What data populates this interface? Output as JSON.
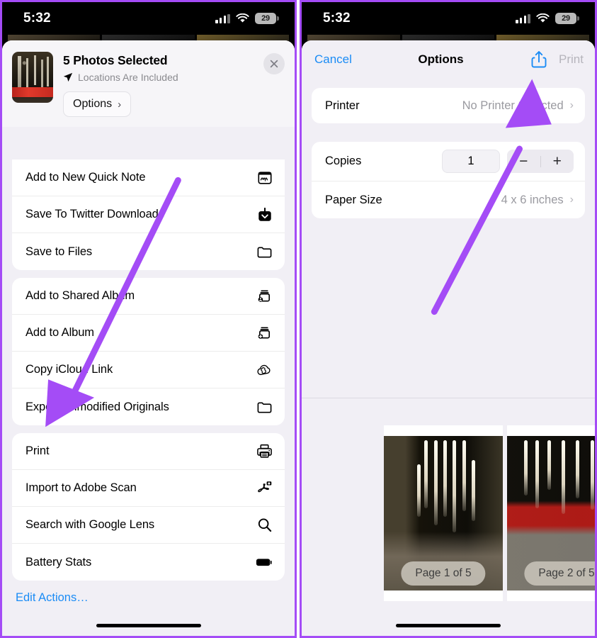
{
  "status_bar": {
    "time": "5:32",
    "battery": "29",
    "wifi_icon": "wifi-icon",
    "cellular_icon": "cellular-signal-icon"
  },
  "colors": {
    "accent_blue": "#1b8cf5",
    "annotation_purple": "#a44cf6",
    "sheet_bg": "#f1eff5",
    "muted": "#9a9aa0"
  },
  "left_panel": {
    "header": {
      "title": "5 Photos Selected",
      "subtitle": "Locations Are Included",
      "location_icon": "location-arrow-icon",
      "options_label": "Options",
      "options_chevron": "›",
      "close_icon": "close-icon"
    },
    "groups": [
      {
        "clipped": true,
        "rows": [
          {
            "label": "Add to New Quick Note",
            "icon": "quick-note-icon"
          },
          {
            "label": "Save To Twitter Downloads",
            "icon": "download-box-icon"
          },
          {
            "label": "Save to Files",
            "icon": "folder-icon"
          }
        ]
      },
      {
        "clipped": false,
        "rows": [
          {
            "label": "Add to Shared Album",
            "icon": "shared-album-icon"
          },
          {
            "label": "Add to Album",
            "icon": "add-album-icon"
          },
          {
            "label": "Copy iCloud Link",
            "icon": "icloud-link-icon"
          },
          {
            "label": "Export Unmodified Originals",
            "icon": "folder-icon"
          }
        ]
      },
      {
        "clipped": false,
        "rows": [
          {
            "label": "Print",
            "icon": "printer-icon"
          },
          {
            "label": "Import to Adobe Scan",
            "icon": "adobe-scan-icon"
          },
          {
            "label": "Search with Google Lens",
            "icon": "search-icon"
          },
          {
            "label": "Battery Stats",
            "icon": "battery-icon"
          }
        ]
      }
    ],
    "edit_actions_label": "Edit Actions…"
  },
  "right_panel": {
    "nav": {
      "cancel_label": "Cancel",
      "title": "Options",
      "share_icon": "share-icon",
      "print_label": "Print"
    },
    "printer_row": {
      "label": "Printer",
      "value": "No Printer Selected",
      "chevron": "›"
    },
    "copies_row": {
      "label": "Copies",
      "value": "1",
      "minus_label": "−",
      "plus_label": "+"
    },
    "paper_size_row": {
      "label": "Paper Size",
      "value": "4 x 6 inches",
      "chevron": "›"
    },
    "preview": {
      "pages": [
        {
          "badge": "Page 1 of 5"
        },
        {
          "badge": "Page 2 of 5"
        }
      ]
    }
  },
  "annotations": {
    "left_arrow": "purple-arrow-pointing-to-print",
    "right_arrow": "purple-arrow-pointing-to-share-button"
  }
}
